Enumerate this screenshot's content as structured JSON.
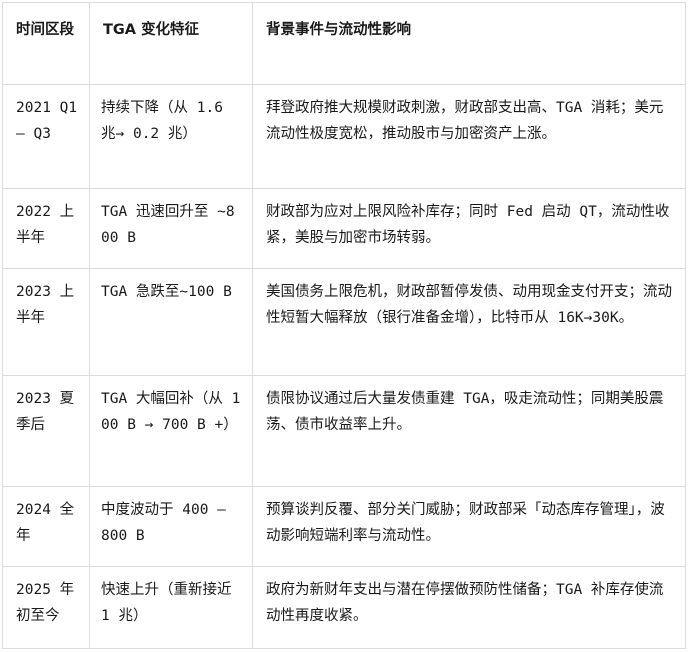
{
  "table": {
    "headers": [
      "时间区段",
      "TGA 变化特征",
      "背景事件与流动性影响"
    ],
    "rows": [
      {
        "period": "2021 Q1 – Q3",
        "tga": "持续下降（从 1.6 兆→ 0.2 兆）",
        "impact": "拜登政府推大规模财政刺激，财政部支出高、TGA 消耗；美元流动性极度宽松，推动股市与加密资产上涨。"
      },
      {
        "period": "2022 上半年",
        "tga": "TGA 迅速回升至 ~800 B",
        "impact": "财政部为应对上限风险补库存；同时 Fed 启动 QT，流动性收紧，美股与加密市场转弱。"
      },
      {
        "period": "2023 上半年",
        "tga": "TGA 急跌至~100 B",
        "impact": "美国债务上限危机，财政部暂停发债、动用现金支付开支；流动性短暂大幅释放（银行准备金增），比特币从 16K→30K。"
      },
      {
        "period": "2023 夏季后",
        "tga": "TGA 大幅回补（从 100 B → 700 B +）",
        "impact": "债限协议通过后大量发债重建 TGA，吸走流动性；同期美股震荡、债市收益率上升。"
      },
      {
        "period": "2024 全年",
        "tga": "中度波动于 400 – 800 B",
        "impact": "预算谈判反覆、部分关门威胁；财政部采「动态库存管理」，波动影响短端利率与流动性。"
      },
      {
        "period": "2025 年初至今",
        "tga": "快速上升（重新接近 1 兆）",
        "impact": "政府为新财年支出与潜在停摆做预防性储备；TGA 补库存使流动性再度收紧。"
      }
    ]
  }
}
